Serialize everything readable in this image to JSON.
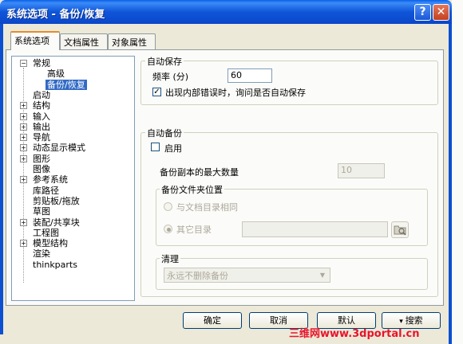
{
  "window": {
    "title": "系统选项 - 备份/恢复",
    "help": "?",
    "close": "✕"
  },
  "tabs": [
    "系统选项",
    "文档属性",
    "对象属性"
  ],
  "tree": {
    "items": [
      {
        "label": "常规",
        "expander": "−"
      },
      {
        "label": "高级",
        "expander": ""
      },
      {
        "label": "备份/恢复",
        "expander": ""
      },
      {
        "label": "启动",
        "expander": ""
      },
      {
        "label": "结构",
        "expander": "+"
      },
      {
        "label": "输入",
        "expander": "+"
      },
      {
        "label": "输出",
        "expander": "+"
      },
      {
        "label": "导航",
        "expander": "+"
      },
      {
        "label": "动态显示模式",
        "expander": "+"
      },
      {
        "label": "图形",
        "expander": "+"
      },
      {
        "label": "图像",
        "expander": ""
      },
      {
        "label": "参考系统",
        "expander": "+"
      },
      {
        "label": "库路径",
        "expander": ""
      },
      {
        "label": "剪贴板/拖放",
        "expander": ""
      },
      {
        "label": "草图",
        "expander": ""
      },
      {
        "label": "装配/共享块",
        "expander": "+"
      },
      {
        "label": "工程图",
        "expander": ""
      },
      {
        "label": "模型结构",
        "expander": "+"
      },
      {
        "label": "渲染",
        "expander": ""
      },
      {
        "label": "thinkparts",
        "expander": ""
      }
    ]
  },
  "autosave": {
    "group_label": "自动保存",
    "frequency_label": "频率 (分)",
    "frequency_value": "60",
    "ask_label": "出现内部错误时，询问是否自动保存",
    "ask_checked": "✓"
  },
  "autobackup": {
    "group_label": "自动备份",
    "enable_label": "启用",
    "max_copies_label": "备份副本的最大数量",
    "max_copies_value": "10",
    "folder_group_label": "备份文件夹位置",
    "same_dir_label": "与文档目录相同",
    "other_dir_label": "其它目录",
    "browse_icon": "folder-browse-icon",
    "cleanup_group_label": "清理",
    "cleanup_value": "永远不删除备份"
  },
  "buttons": {
    "ok": "确定",
    "cancel": "取消",
    "default": "默认",
    "search": "搜索"
  },
  "watermark": "三维网www.3dportal.cn",
  "colors": {
    "title_blue": "#0a47c8",
    "selection": "#316ac5",
    "close_red": "#c3421f"
  }
}
